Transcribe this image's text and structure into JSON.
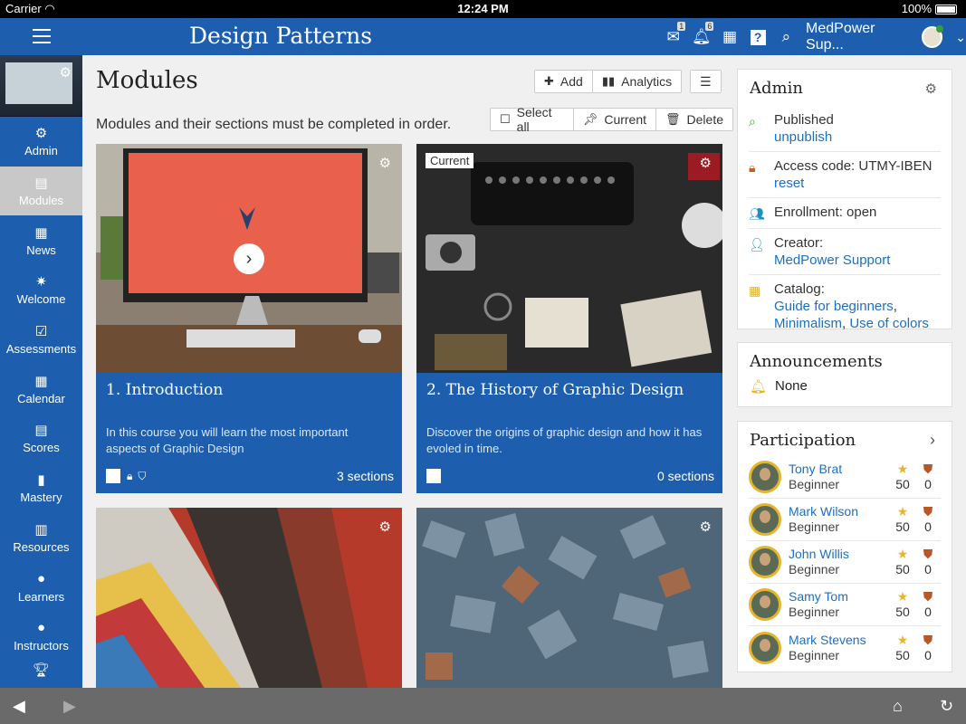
{
  "status_bar": {
    "carrier": "Carrier",
    "time": "12:24 PM",
    "battery": "100%"
  },
  "header": {
    "title": "Design Patterns",
    "user_name": "MedPower Sup...",
    "mail_badge": "1",
    "bell_badge": "6"
  },
  "sidebar": {
    "items": [
      {
        "label": "Admin",
        "icon": "gear-icon",
        "glyph": "⚙"
      },
      {
        "label": "Modules",
        "icon": "book-icon",
        "glyph": "▤"
      },
      {
        "label": "News",
        "icon": "newspaper-icon",
        "glyph": "▦"
      },
      {
        "label": "Welcome",
        "icon": "sparkle-icon",
        "glyph": "✷"
      },
      {
        "label": "Assessments",
        "icon": "checkbox-icon",
        "glyph": "☑"
      },
      {
        "label": "Calendar",
        "icon": "calendar-icon",
        "glyph": "▦"
      },
      {
        "label": "Scores",
        "icon": "scores-icon",
        "glyph": "▤"
      },
      {
        "label": "Mastery",
        "icon": "bar-chart-icon",
        "glyph": "▮"
      },
      {
        "label": "Resources",
        "icon": "resources-icon",
        "glyph": "▥"
      },
      {
        "label": "Learners",
        "icon": "user-icon",
        "glyph": "●"
      },
      {
        "label": "Instructors",
        "icon": "instructor-icon",
        "glyph": "●"
      }
    ]
  },
  "main": {
    "title": "Modules",
    "subtitle": "Modules and their sections must be completed in order.",
    "toolbar": {
      "add": "Add",
      "analytics": "Analytics",
      "select_all": "Select all",
      "current": "Current",
      "delete": "Delete"
    },
    "cards": [
      {
        "title": "1. Introduction",
        "description": "In this course you will learn the most important aspects of Graphic Design",
        "sections": "3 sections"
      },
      {
        "title": "2. The History of Graphic Design",
        "description": "Discover the origins of graphic design and how it has evoled in time.",
        "sections": "0 sections",
        "tag": "Current"
      }
    ]
  },
  "admin": {
    "title": "Admin",
    "published": "Published",
    "unpublish": "unpublish",
    "access_code": "Access code: UTMY-IBEN",
    "reset": "reset",
    "enrollment": "Enrollment: open",
    "creator_label": "Creator:",
    "creator": "MedPower Support",
    "catalog_label": "Catalog:",
    "catalog1": "Guide for beginners",
    "sep1": ",",
    "catalog2": "Minimalism",
    "sep2": ",",
    "catalog3": "Use of colors"
  },
  "announcements": {
    "title": "Announcements",
    "value": "None"
  },
  "participation": {
    "title": "Participation",
    "people": [
      {
        "name": "Tony Brat",
        "level": "Beginner",
        "stars": "50",
        "badges": "0"
      },
      {
        "name": "Mark Wilson",
        "level": "Beginner",
        "stars": "50",
        "badges": "0"
      },
      {
        "name": "John Willis",
        "level": "Beginner",
        "stars": "50",
        "badges": "0"
      },
      {
        "name": "Samy Tom",
        "level": "Beginner",
        "stars": "50",
        "badges": "0"
      },
      {
        "name": "Mark Stevens",
        "level": "Beginner",
        "stars": "50",
        "badges": "0"
      }
    ]
  },
  "colors": {
    "primary": "#1d5fae",
    "link": "#1d6fc0",
    "star": "#e6b52c",
    "badge": "#b8582a"
  }
}
